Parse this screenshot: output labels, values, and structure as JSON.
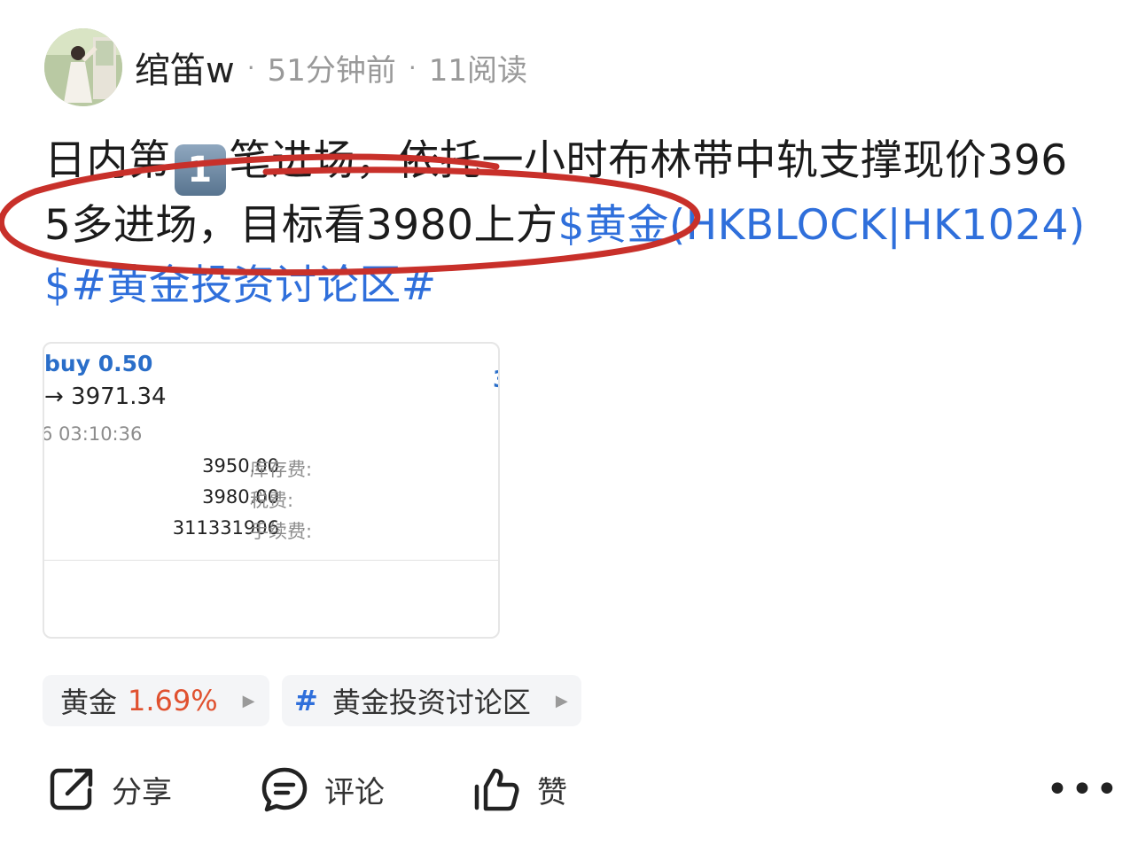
{
  "header": {
    "author": "绾笛w",
    "separator": "·",
    "time_ago": "51分钟前",
    "reads": "11阅读"
  },
  "post": {
    "text_part1": "日内第",
    "keycap": "1",
    "text_part2": "笔进场，依托一小时布林带中轨支撑现价3965多进场，目标看3980上方",
    "stock_link": "$黄金(HKBLOCK|HK1024)$",
    "topic_link": "#黄金投资讨论区#",
    "annotation_color": "#c8302a"
  },
  "card": {
    "order": "buy 0.50",
    "price_change": "→ 3971.34",
    "timestamp": "6 03:10:36",
    "rows": [
      {
        "value": "3950.00",
        "label": "库存费:"
      },
      {
        "value": "3980.00",
        "label": "税费:"
      },
      {
        "value": "311331906",
        "label": "手续费:"
      }
    ]
  },
  "tags": {
    "stock_name": "黄金",
    "stock_change": "1.69%",
    "topic_hash": "#",
    "topic_name": "黄金投资讨论区"
  },
  "actions": {
    "share": "分享",
    "comment": "评论",
    "like": "赞",
    "more": "•••"
  },
  "colors": {
    "link": "#2f6fdb",
    "up": "#e0512f",
    "tag_bg": "#f4f5f7"
  }
}
